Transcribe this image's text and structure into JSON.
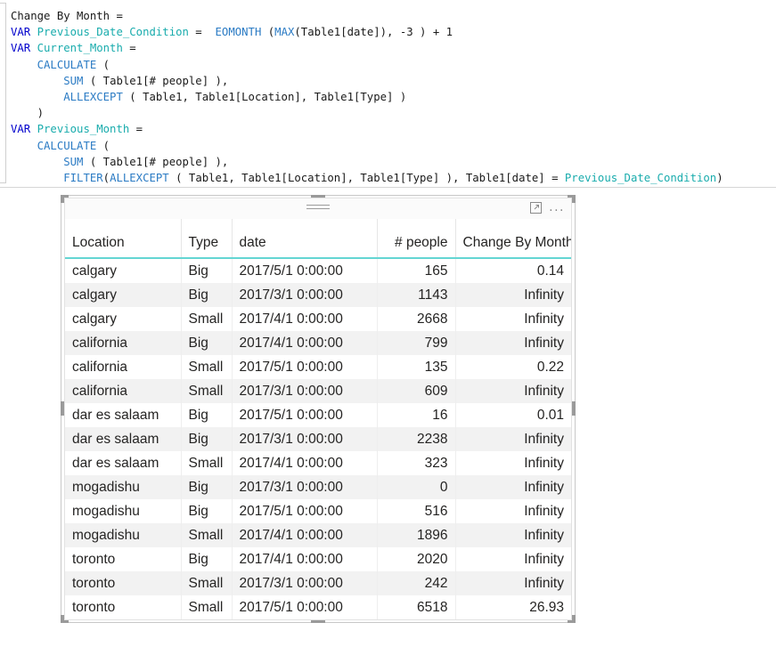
{
  "formula": {
    "measure_name": "Change By Month =",
    "lines": [
      [
        {
          "t": "Change By Month =",
          "c": "plain"
        }
      ],
      [
        {
          "t": "VAR ",
          "c": "kw"
        },
        {
          "t": "Previous_Date_Condition",
          "c": "var"
        },
        {
          "t": " =  ",
          "c": "plain"
        },
        {
          "t": "EOMONTH",
          "c": "fn"
        },
        {
          "t": " (",
          "c": "plain"
        },
        {
          "t": "MAX",
          "c": "fn"
        },
        {
          "t": "(Table1[date]), -3 ) + 1",
          "c": "plain"
        }
      ],
      [
        {
          "t": "VAR ",
          "c": "kw"
        },
        {
          "t": "Current_Month",
          "c": "var"
        },
        {
          "t": " =",
          "c": "plain"
        }
      ],
      [
        {
          "t": "    ",
          "c": "plain"
        },
        {
          "t": "CALCULATE",
          "c": "fn"
        },
        {
          "t": " (",
          "c": "plain"
        }
      ],
      [
        {
          "t": "        ",
          "c": "plain"
        },
        {
          "t": "SUM",
          "c": "fn"
        },
        {
          "t": " ( Table1[# people] ),",
          "c": "plain"
        }
      ],
      [
        {
          "t": "        ",
          "c": "plain"
        },
        {
          "t": "ALLEXCEPT",
          "c": "fn"
        },
        {
          "t": " ( Table1, Table1[Location], Table1[Type] )",
          "c": "plain"
        }
      ],
      [
        {
          "t": "    )",
          "c": "plain"
        }
      ],
      [
        {
          "t": "VAR ",
          "c": "kw"
        },
        {
          "t": "Previous_Month",
          "c": "var"
        },
        {
          "t": " =",
          "c": "plain"
        }
      ],
      [
        {
          "t": "    ",
          "c": "plain"
        },
        {
          "t": "CALCULATE",
          "c": "fn"
        },
        {
          "t": " (",
          "c": "plain"
        }
      ],
      [
        {
          "t": "        ",
          "c": "plain"
        },
        {
          "t": "SUM",
          "c": "fn"
        },
        {
          "t": " ( Table1[# people] ),",
          "c": "plain"
        }
      ],
      [
        {
          "t": "        ",
          "c": "plain"
        },
        {
          "t": "FILTER",
          "c": "fn"
        },
        {
          "t": "(",
          "c": "plain"
        },
        {
          "t": "ALLEXCEPT",
          "c": "fn"
        },
        {
          "t": " ( Table1, Table1[Location], Table1[Type] ), Table1[date] = ",
          "c": "plain"
        },
        {
          "t": "Previous_Date_Condition",
          "c": "var"
        },
        {
          "t": ")",
          "c": "plain"
        }
      ]
    ]
  },
  "visual": {
    "accent_color": "#64d6d3",
    "focus_icon": "focus-mode-icon",
    "more_icon": "more-options-icon",
    "more_label": "...",
    "columns": [
      {
        "key": "location",
        "label": "Location",
        "align": "left"
      },
      {
        "key": "type",
        "label": "Type",
        "align": "left"
      },
      {
        "key": "date",
        "label": "date",
        "align": "left"
      },
      {
        "key": "people",
        "label": "# people",
        "align": "right"
      },
      {
        "key": "change",
        "label": "Change By Month",
        "align": "right"
      }
    ],
    "rows": [
      {
        "location": "calgary",
        "type": "Big",
        "date": "2017/5/1 0:00:00",
        "people": "165",
        "change": "0.14"
      },
      {
        "location": "calgary",
        "type": "Big",
        "date": "2017/3/1 0:00:00",
        "people": "1143",
        "change": "Infinity"
      },
      {
        "location": "calgary",
        "type": "Small",
        "date": "2017/4/1 0:00:00",
        "people": "2668",
        "change": "Infinity"
      },
      {
        "location": "california",
        "type": "Big",
        "date": "2017/4/1 0:00:00",
        "people": "799",
        "change": "Infinity"
      },
      {
        "location": "california",
        "type": "Small",
        "date": "2017/5/1 0:00:00",
        "people": "135",
        "change": "0.22"
      },
      {
        "location": "california",
        "type": "Small",
        "date": "2017/3/1 0:00:00",
        "people": "609",
        "change": "Infinity"
      },
      {
        "location": "dar es salaam",
        "type": "Big",
        "date": "2017/5/1 0:00:00",
        "people": "16",
        "change": "0.01"
      },
      {
        "location": "dar es salaam",
        "type": "Big",
        "date": "2017/3/1 0:00:00",
        "people": "2238",
        "change": "Infinity"
      },
      {
        "location": "dar es salaam",
        "type": "Small",
        "date": "2017/4/1 0:00:00",
        "people": "323",
        "change": "Infinity"
      },
      {
        "location": "mogadishu",
        "type": "Big",
        "date": "2017/3/1 0:00:00",
        "people": "0",
        "change": "Infinity"
      },
      {
        "location": "mogadishu",
        "type": "Big",
        "date": "2017/5/1 0:00:00",
        "people": "516",
        "change": "Infinity"
      },
      {
        "location": "mogadishu",
        "type": "Small",
        "date": "2017/4/1 0:00:00",
        "people": "1896",
        "change": "Infinity"
      },
      {
        "location": "toronto",
        "type": "Big",
        "date": "2017/4/1 0:00:00",
        "people": "2020",
        "change": "Infinity"
      },
      {
        "location": "toronto",
        "type": "Small",
        "date": "2017/3/1 0:00:00",
        "people": "242",
        "change": "Infinity"
      },
      {
        "location": "toronto",
        "type": "Small",
        "date": "2017/5/1 0:00:00",
        "people": "6518",
        "change": "26.93"
      }
    ]
  }
}
